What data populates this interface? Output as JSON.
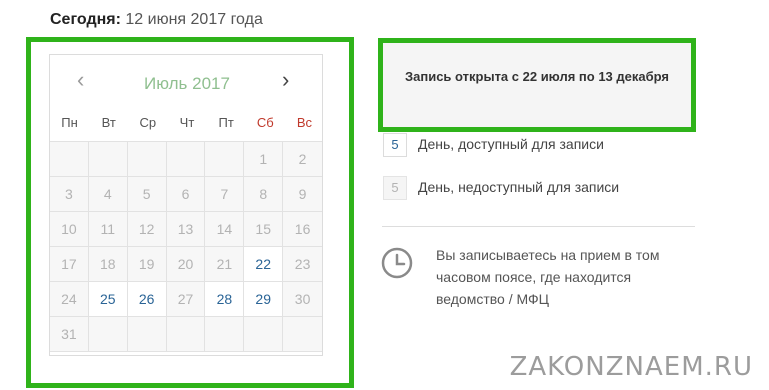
{
  "today": {
    "label": "Сегодня:",
    "value": "12 июня 2017 года"
  },
  "calendar": {
    "prev_icon": "‹",
    "next_icon": "›",
    "month_title": "Июль 2017",
    "weekdays": [
      {
        "label": "Пн",
        "weekend": false
      },
      {
        "label": "Вт",
        "weekend": false
      },
      {
        "label": "Ср",
        "weekend": false
      },
      {
        "label": "Чт",
        "weekend": false
      },
      {
        "label": "Пт",
        "weekend": false
      },
      {
        "label": "Сб",
        "weekend": true
      },
      {
        "label": "Вс",
        "weekend": true
      }
    ],
    "days": [
      {
        "d": "",
        "available": false
      },
      {
        "d": "",
        "available": false
      },
      {
        "d": "",
        "available": false
      },
      {
        "d": "",
        "available": false
      },
      {
        "d": "",
        "available": false
      },
      {
        "d": "1",
        "available": false
      },
      {
        "d": "2",
        "available": false
      },
      {
        "d": "3",
        "available": false
      },
      {
        "d": "4",
        "available": false
      },
      {
        "d": "5",
        "available": false
      },
      {
        "d": "6",
        "available": false
      },
      {
        "d": "7",
        "available": false
      },
      {
        "d": "8",
        "available": false
      },
      {
        "d": "9",
        "available": false
      },
      {
        "d": "10",
        "available": false
      },
      {
        "d": "11",
        "available": false
      },
      {
        "d": "12",
        "available": false
      },
      {
        "d": "13",
        "available": false
      },
      {
        "d": "14",
        "available": false
      },
      {
        "d": "15",
        "available": false
      },
      {
        "d": "16",
        "available": false
      },
      {
        "d": "17",
        "available": false
      },
      {
        "d": "18",
        "available": false
      },
      {
        "d": "19",
        "available": false
      },
      {
        "d": "20",
        "available": false
      },
      {
        "d": "21",
        "available": false
      },
      {
        "d": "22",
        "available": true
      },
      {
        "d": "23",
        "available": false
      },
      {
        "d": "24",
        "available": false
      },
      {
        "d": "25",
        "available": true
      },
      {
        "d": "26",
        "available": true
      },
      {
        "d": "27",
        "available": false
      },
      {
        "d": "28",
        "available": true
      },
      {
        "d": "29",
        "available": true
      },
      {
        "d": "30",
        "available": false
      },
      {
        "d": "31",
        "available": false
      },
      {
        "d": "",
        "available": false
      },
      {
        "d": "",
        "available": false
      },
      {
        "d": "",
        "available": false
      },
      {
        "d": "",
        "available": false
      },
      {
        "d": "",
        "available": false
      },
      {
        "d": "",
        "available": false
      }
    ]
  },
  "notice": {
    "text": "Запись открыта с 22 июля по 13 декабря"
  },
  "legend": {
    "available": {
      "sample": "5",
      "label": "День, доступный для записи"
    },
    "unavailable": {
      "sample": "5",
      "label": "День, недоступный для записи"
    }
  },
  "timezone": {
    "icon": "clock-icon",
    "text": "Вы записываетесь на прием в том часовом поясе, где находится ведомство / МФЦ"
  },
  "watermark": "ZAKONZNAEM.RU",
  "colors": {
    "highlight_border": "#2fb31a",
    "available_day": "#2a6496",
    "weekend_header": "#c0392b"
  }
}
